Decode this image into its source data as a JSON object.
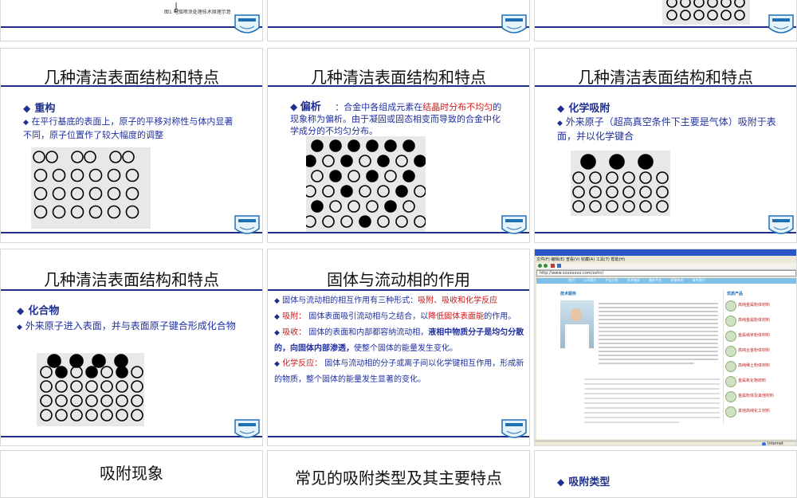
{
  "common": {
    "title": "几种清洁表面结构和特点",
    "bullet": "◆"
  },
  "slides": {
    "s1": {
      "caption": "图1 电弧喷涂处理技术原理示意"
    },
    "s4": {
      "head": "重构",
      "desc": "在平行基底的表面上，原子的平移对称性与体内显著不同，原子位置作了较大幅度的调整"
    },
    "s5": {
      "head": "偏析",
      "sep": "：",
      "desc_a": "合金中各组成元素在",
      "desc_red": "结晶时分布不均匀",
      "desc_b": "的现象称为偏析。由于凝固或固态相变而导致的合金中化学成分的不均匀分布。"
    },
    "s6": {
      "head": "化学吸附",
      "desc": "外来原子（超高真空条件下主要是气体）吸附于表面，并以化学键合"
    },
    "s7": {
      "head": "化合物",
      "desc": "外来原子进入表面，并与表面原子键合形成化合物"
    },
    "s8": {
      "title": "固体与流动相的作用",
      "p1_a": "固体与流动相的相互作用有三种形式：",
      "p1_red": "吸附、吸收和化学反应",
      "p2_red": "吸附：",
      "p2_a": "固体表面吸引流动相与之结合，以",
      "p2_red2": "降低固体表面能",
      "p2_b": "的作用。",
      "p3_red": "吸收：",
      "p3_a": "固体的表面和内部都容纳流动相，",
      "p3_em": "液相中物质分子是均匀分散的，向固体内部渗透，",
      "p3_b": "使整个固体的能量发生变化。",
      "p4_red": "化学反应：",
      "p4_a": "固体与流动相的分子或离子间以化学键相互作用，形成新的物质，整个固体的能量发生显著的变化。"
    },
    "s9": {
      "address": "http://www.xxxxxxxx.com/xxhn/",
      "menu": [
        "文件(F)",
        "编辑(E)",
        "查看(V)",
        "收藏(A)",
        "工具(T)",
        "帮助(H)"
      ],
      "nav": [
        "首页",
        "公司简介",
        "产品介绍",
        "技术服务",
        "服务平台",
        "质量体系",
        "联系我们"
      ],
      "section": "技术服务",
      "side_title": "优质产品",
      "side_items": [
        "高纯金属粉体材料",
        "高纯金属粉体材料",
        "金属纳米粉体材料",
        "高纯合金粉体材料",
        "高纯稀土粉体材料",
        "金属氧化物材料",
        "金属粉体及其他材料",
        "其他高纯化工材料"
      ],
      "status": "Internet"
    },
    "s10": {
      "title": "吸附现象"
    },
    "s11": {
      "title": "常见的吸附类型及其主要特点"
    },
    "s12": {
      "head": "吸附类型"
    }
  },
  "colors": {
    "accent": "#1f2f8f",
    "red": "#d01818"
  }
}
